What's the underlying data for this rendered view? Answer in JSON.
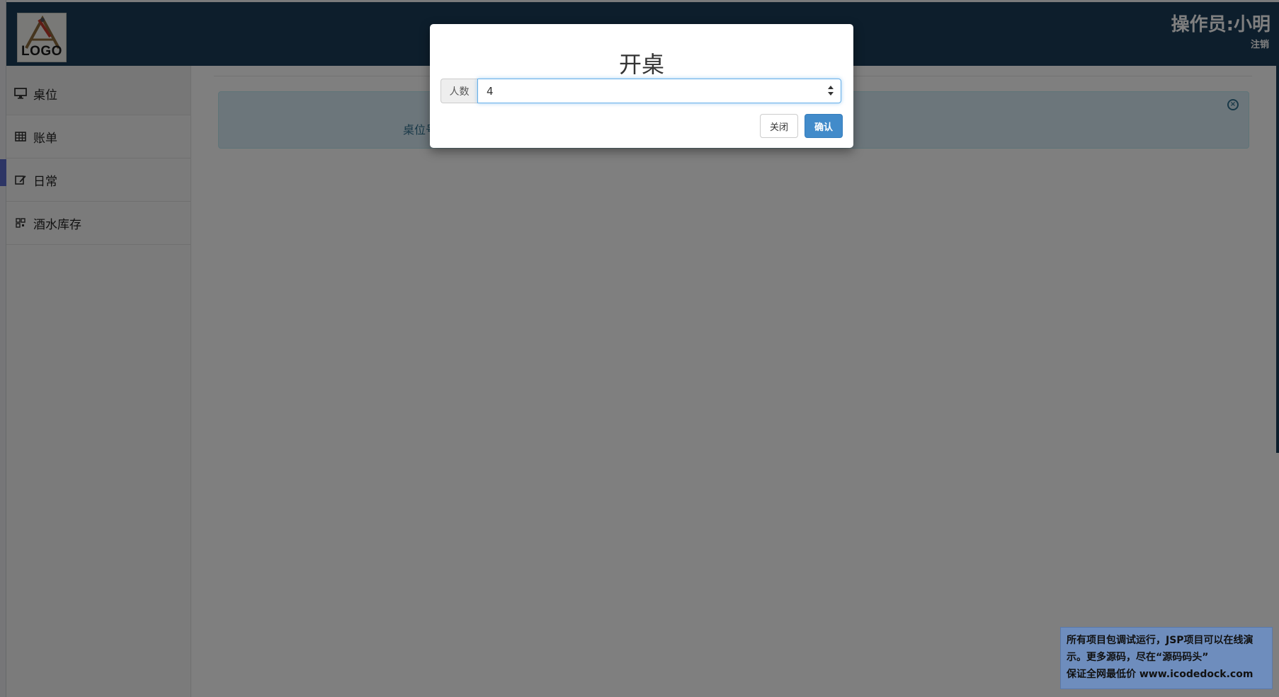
{
  "header": {
    "logo_text": "LOGO",
    "operator": "操作员:小明",
    "logout_label": "注销"
  },
  "sidebar": {
    "items": [
      {
        "label": "桌位",
        "icon": "monitor-icon"
      },
      {
        "label": "账单",
        "icon": "table-icon"
      },
      {
        "label": "日常",
        "icon": "edit-icon"
      },
      {
        "label": "酒水库存",
        "icon": "qrcode-icon"
      }
    ]
  },
  "main": {
    "alert_text": "桌位号"
  },
  "modal": {
    "title": "开桌",
    "field_label": "人数",
    "field_value": "4",
    "close_label": "关闭",
    "confirm_label": "确认"
  },
  "banner": {
    "line1": "所有项目包调试运行，JSP项目可以在线演",
    "line2": "示。更多源码，尽在“源码码头”",
    "line3": "保证全网最低价 www.icodedock.com"
  },
  "colors": {
    "header_bg": "#1a3c58",
    "primary_button": "#428bca",
    "alert_bg": "#d9edf7",
    "banner_bg": "#6e8dbd"
  }
}
